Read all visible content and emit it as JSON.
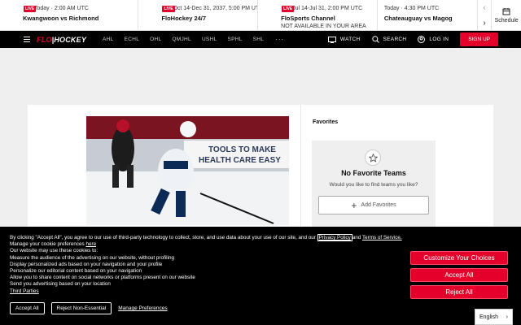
{
  "schedule": {
    "live_badge": "LIVE",
    "events": [
      {
        "live": true,
        "time": "Today · 2:00 AM UTC",
        "title": "Kwangwoon vs Richmond",
        "sub": ""
      },
      {
        "live": true,
        "time": "Oct 14-Dec 31, 2037, 5:00 PM UTC",
        "title": "FloHockey 24/7",
        "sub": ""
      },
      {
        "live": true,
        "time": "Jul 14-Jul 31, 2:00 PM UTC",
        "title": "FloSports Channel",
        "sub": "NOT AVAILABLE IN YOUR AREA"
      },
      {
        "live": false,
        "time": "Today · 4:30 PM UTC",
        "title": "Chateauguay vs Magog",
        "sub": ""
      }
    ],
    "prev_icon": "chevron-left-icon",
    "next_icon": "chevron-right-icon",
    "schedule_label": "Schedule"
  },
  "nav": {
    "logo_prefix": "FLO",
    "logo_sep": "|",
    "logo_suffix": "HOCKEY",
    "leagues": [
      "AHL",
      "ECHL",
      "OHL",
      "QMJHL",
      "USHL",
      "SPHL",
      "SHL"
    ],
    "more": "···",
    "watch": "WATCH",
    "search": "SEARCH",
    "login": "LOG IN",
    "signup": "SIGN UP"
  },
  "photo_text": {
    "line1": "TOOLS TO MAKE",
    "line2": "HEALTH CARE EASY"
  },
  "favorites": {
    "heading": "Favorites",
    "empty_title": "No Favorite Teams",
    "empty_sub": "Would you like to find teams you like?",
    "add_label": "Add Favorites"
  },
  "cookie": {
    "intro": "By clicking \"Accept All\", you agree to our use of third-party technology to collect, store, and use data about your use of our site, and our",
    "privacy": "Privacy Policy",
    "and": "and",
    "terms": "Terms of Service.",
    "manage_line": "Manage your cookie preferences",
    "here": "here",
    "items": [
      "Our website may use these cookies to:",
      "Measure the audience of the advertising on our website, without profiling",
      "Display personalized ads based on your navigation and your profile",
      "Personalize our editorial content based on your navigation",
      "Allow you to share content on social networks or platforms present on our website",
      "Send you advertising based on your location"
    ],
    "third_parties": "Third Parties",
    "accept_all_small": "Accept All",
    "reject_non_essential": "Reject Non-Essential",
    "manage_prefs": "Manage Preferences",
    "customize": "Customize Your Choices",
    "accept_all": "Accept All",
    "reject_all": "Reject All"
  },
  "language": {
    "selected": "English"
  },
  "colors": {
    "brand_red": "#e4002b",
    "nav_bg": "#000000"
  }
}
